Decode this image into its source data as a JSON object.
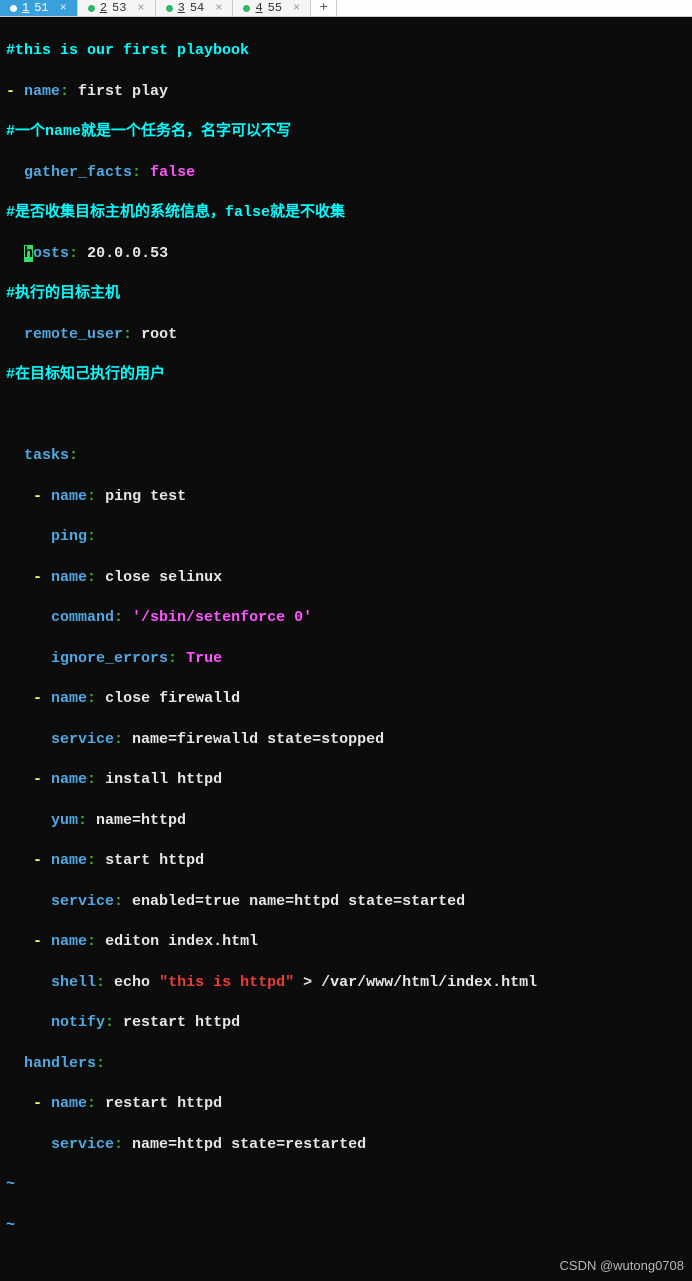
{
  "tabs": [
    {
      "modified": true,
      "num": "1",
      "label": "51",
      "active": true
    },
    {
      "modified": true,
      "num": "2",
      "label": "53",
      "active": false
    },
    {
      "modified": true,
      "num": "3",
      "label": "54",
      "active": false
    },
    {
      "modified": true,
      "num": "4",
      "label": "55",
      "active": false
    }
  ],
  "newTab": "+",
  "code": {
    "c1": "#this is our first playbook",
    "dash": "- ",
    "k_name": "name",
    "colon": ":",
    "v_firstplay": " first play",
    "c2": "#一个name就是一个任务名，名字可以不写",
    "k_gather": "gather_facts",
    "v_false": " false",
    "c3": "#是否收集目标主机的系统信息，false就是不收集",
    "cursor_h": "h",
    "k_osts": "osts",
    "v_hosts": " 20.0.0.53",
    "c4": "#执行的目标主机",
    "k_remote": "remote_user",
    "v_root": " root",
    "c5": "#在目标知己执行的用户",
    "k_tasks": "tasks",
    "v_ping": " ping test",
    "k_ping": "ping",
    "v_closeselinux": " close selinux",
    "k_command": "command",
    "v_setenforce": " '/sbin/setenforce 0'",
    "k_ignore": "ignore_errors",
    "v_true": " True",
    "v_closefw": " close firewalld",
    "k_service": "service",
    "v_fwstop": " name=firewalld state=stopped",
    "v_installhttpd": " install httpd",
    "k_yum": "yum",
    "v_yumhttpd": " name=httpd",
    "v_starthttpd": " start httpd",
    "v_svcstart": " enabled=true name=httpd state=started",
    "v_editon": " editon index.html",
    "k_shell": "shell",
    "v_echo_pre": " echo ",
    "v_echo_str": "\"this is httpd\"",
    "v_echo_post": " > /var/www/html/index.html",
    "k_notify": "notify",
    "v_restart": " restart httpd",
    "k_handlers": "handlers",
    "v_restarthttpd": " restart httpd",
    "v_svcrestart": " name=httpd state=restarted",
    "tilde": "~"
  },
  "watermark": "CSDN @wutong0708"
}
